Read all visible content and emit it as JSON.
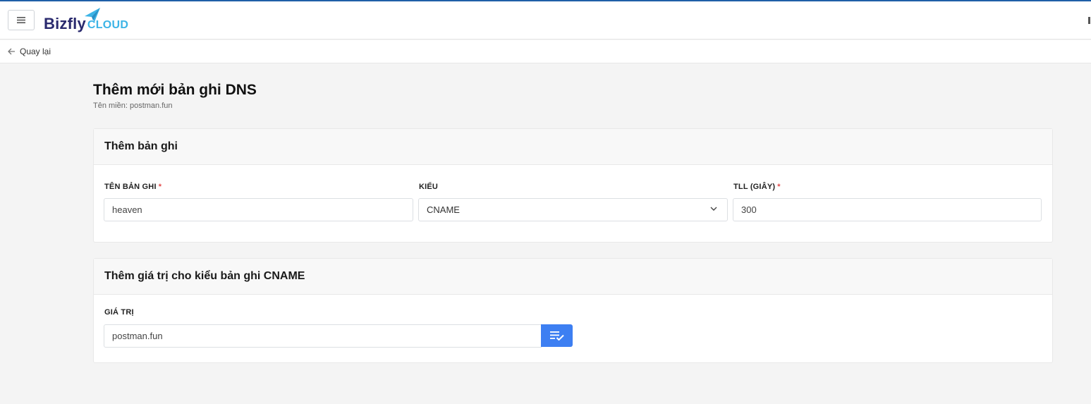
{
  "header": {
    "logo_main": "Bizfly",
    "logo_sub": "CLOUD",
    "menu_icon": "hamburger-menu-icon"
  },
  "nav": {
    "back_label": "Quay lại",
    "back_icon": "arrow-left-icon"
  },
  "page": {
    "title": "Thêm mới bản ghi DNS",
    "subtitle": "Tên miền: postman.fun"
  },
  "record_card": {
    "title": "Thêm bản ghi",
    "name_label": "TÊN BẢN GHI",
    "name_value": "heaven",
    "type_label": "KIỂU",
    "type_value": "CNAME",
    "ttl_label": "TLL (GIÂY)",
    "ttl_value": "300",
    "required_mark": "*"
  },
  "value_card": {
    "title": "Thêm giá trị cho kiểu bản ghi CNAME",
    "value_label": "GIÁ TRỊ",
    "value_value": "postman.fun",
    "action_icon": "list-check-icon"
  },
  "colors": {
    "accent": "#3d7ff2",
    "brand_dark": "#2a2a6e",
    "brand_light": "#3cb4e6",
    "required": "#e24c4c"
  }
}
